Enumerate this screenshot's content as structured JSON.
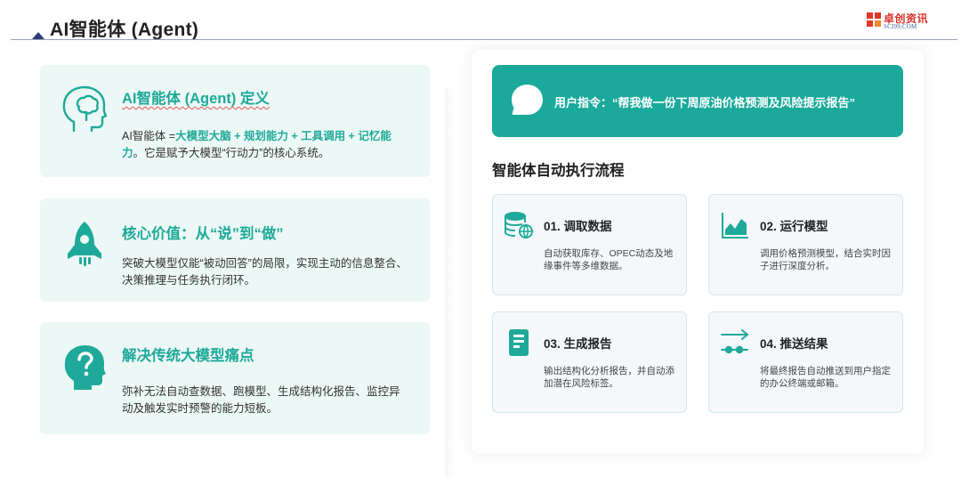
{
  "header": {
    "title": "AI智能体 (Agent)"
  },
  "logo": {
    "name_cn": "卓创资讯",
    "name_en": "SCI99.COM"
  },
  "left_cards": [
    {
      "icon": "brain-head-icon",
      "title": "AI智能体 (Agent) 定义",
      "desc_prefix": "AI智能体 =",
      "desc_highlight": "大模型大脑 + 规划能力 + 工具调用 + 记忆能力",
      "desc_suffix": "。它是赋予大模型“行动力”的核心系统。"
    },
    {
      "icon": "rocket-icon",
      "title": "核心价值：从“说”到“做”",
      "desc": "突破大模型仅能“被动回答”的局限，实现主动的信息整合、决策推理与任务执行闭环。"
    },
    {
      "icon": "question-head-icon",
      "title": "解决传统大模型痛点",
      "desc": "弥补无法自动查数据、跑模型、生成结构化报告、监控异动及触发实时预警的能力短板。"
    }
  ],
  "banner": {
    "icon": "speech-bubble-icon",
    "text": "用户指令：“帮我做一份下周原油价格预测及风险提示报告”"
  },
  "flow": {
    "title": "智能体自动执行流程",
    "steps": [
      {
        "icon": "database-globe-icon",
        "title": "01. 调取数据",
        "desc": "自动获取库存、OPEC动态及地缘事件等多维数据。"
      },
      {
        "icon": "area-chart-icon",
        "title": "02. 运行模型",
        "desc": "调用价格预测模型，结合实时因子进行深度分析。"
      },
      {
        "icon": "report-document-icon",
        "title": "03. 生成报告",
        "desc": "输出结构化分析报告，并自动添加潜在风险标签。"
      },
      {
        "icon": "push-arrow-icon",
        "title": "04. 推送结果",
        "desc": "将最终报告自动推送到用户指定的办公终端或邮箱。"
      }
    ]
  },
  "colors": {
    "accent": "#1fa99a",
    "banner": "#1aa99b",
    "card_bg": "#ecf8f5",
    "step_bg": "#f4f8fb",
    "title_triangle": "#2a3f73"
  }
}
